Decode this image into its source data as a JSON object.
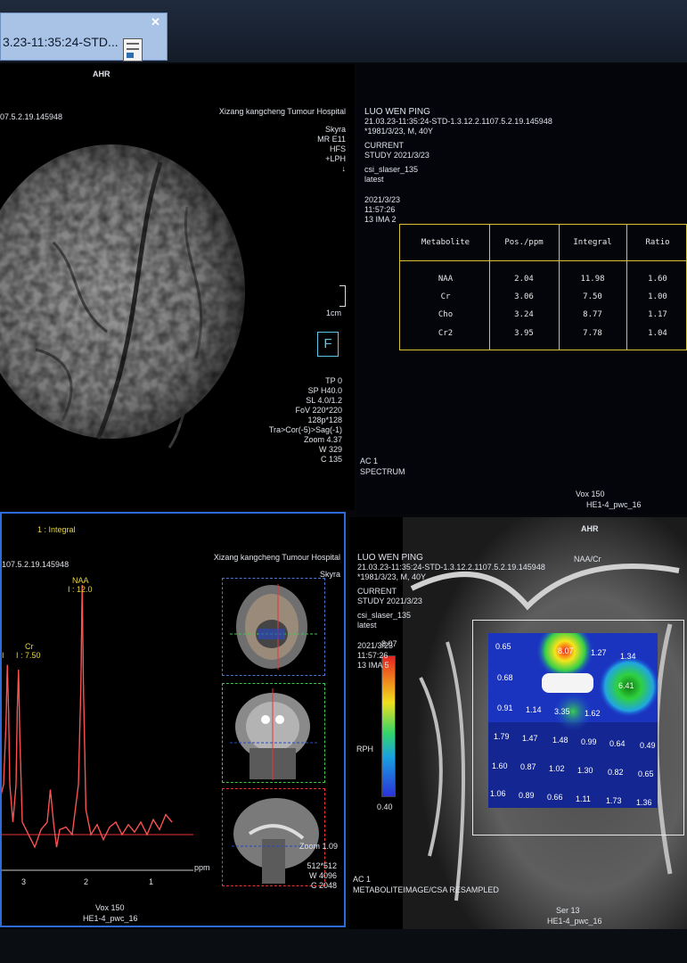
{
  "tab": {
    "title": "3.23-11:35:24-STD..."
  },
  "viewer1": {
    "orientation": "AHR",
    "id_partial": "07.5.2.19.145948",
    "hospital": "Xizang kangcheng Tumour Hospital",
    "scanner": [
      "Skyra",
      "MR E11",
      "HFS",
      "+LPH",
      "↓"
    ],
    "scale": "1cm",
    "params": [
      "TP 0",
      "SP H40.0",
      "SL 4.0/1.2",
      "FoV 220*220",
      "128p*128",
      "Tra>Cor(-5)>Sag(-1)",
      "Zoom 4.37",
      "W   329",
      "C   135"
    ]
  },
  "viewer2": {
    "patient": "LUO WEN PING",
    "study_id": "21.03.23-11:35:24-STD-1.3.12.2.1107.5.2.19.145948",
    "dob": "*1981/3/23, M, 40Y",
    "current": "CURRENT",
    "study": "STUDY 2021/3/23",
    "sequence": "csi_slaser_135",
    "latest": "latest",
    "date": "2021/3/23",
    "time": "11:57:26",
    "ima": "13 IMA 2",
    "ac": "AC 1",
    "mode": "SPECTRUM",
    "vox": "Vox 150",
    "coil": "HE1-4_pwc_16",
    "table": {
      "headers": [
        "Metabolite",
        "Pos./ppm",
        "Integral",
        "Ratio"
      ],
      "rows": [
        [
          "NAA",
          "2.04",
          "11.98",
          "1.60"
        ],
        [
          "Cr",
          "3.06",
          "7.50",
          "1.00"
        ],
        [
          "Cho",
          "3.24",
          "8.77",
          "1.17"
        ],
        [
          "Cr2",
          "3.95",
          "7.78",
          "1.04"
        ]
      ]
    }
  },
  "viewer3": {
    "mode": "1 : Integral",
    "id_partial": "107.5.2.19.145948",
    "hospital": "Xizang kangcheng Tumour Hospital",
    "scanner": "Skyra",
    "naa_label": "NAA",
    "naa_value": "I : 12.0",
    "cr_label": "Cr",
    "cr_value": "I : 7.50",
    "partial_label": "I",
    "axis_ticks": [
      "3",
      "2",
      "1"
    ],
    "axis_unit": "ppm",
    "zoom": "Zoom 1.09",
    "matrix": "512*512",
    "w": "W    4096",
    "c": "C    2048",
    "vox": "Vox 150",
    "coil": "HE1-4_pwc_16"
  },
  "viewer4": {
    "orientation": "AHR",
    "patient": "LUO WEN PING",
    "study_id": "21.03.23-11:35:24-STD-1.3.12.2.1107.5.2.19.145948",
    "dob": "*1981/3/23, M, 40Y",
    "current": "CURRENT",
    "study": "STUDY 2021/3/23",
    "sequence": "csi_slaser_135",
    "latest": "latest",
    "scale_max": "8.07",
    "date": "2021/3/23",
    "time": "11:57:26",
    "ima": "13 IMA 5",
    "rph": "RPH",
    "scale_min": "0.40",
    "naa_cr": "NAA/Cr",
    "ac": "AC 1",
    "mode": "METABOLITEIMAGE/CSA RESAMPLED",
    "ser": "Ser 13",
    "coil": "HE1-4_pwc_16",
    "grid_values": [
      "0.65",
      "8.07",
      "1.27",
      "1.34",
      "0.68",
      "6.41",
      "0.91",
      "1.14",
      "3.35",
      "1.62",
      "1.79",
      "1.47",
      "1.48",
      "0.99",
      "0.64",
      "0.49",
      "1.60",
      "0.87",
      "1.02",
      "1.30",
      "0.82",
      "0.65",
      "1.06",
      "0.89",
      "0.66",
      "1.11",
      "1.73",
      "1.36"
    ]
  },
  "spectrum": {
    "x_ppm": [
      4.2,
      4.1,
      4.0,
      3.98,
      3.95,
      3.92,
      3.9,
      3.8,
      3.4,
      3.3,
      3.26,
      3.24,
      3.22,
      3.2,
      3.15,
      3.1,
      3.08,
      3.06,
      3.04,
      3.0,
      2.9,
      2.8,
      2.7,
      2.6,
      2.55,
      2.5,
      2.45,
      2.4,
      2.3,
      2.2,
      2.1,
      2.06,
      2.04,
      2.02,
      1.98,
      1.9,
      1.8,
      1.7,
      1.6,
      1.5,
      1.4,
      1.3,
      1.2,
      1.1,
      1.0,
      0.9,
      0.8,
      0.7,
      0.6
    ],
    "y": [
      0.05,
      0.1,
      0.2,
      0.45,
      0.63,
      0.4,
      0.15,
      0.05,
      0.1,
      0.2,
      0.45,
      0.68,
      0.5,
      0.2,
      0.05,
      0.2,
      0.5,
      0.66,
      0.4,
      0.05,
      0.0,
      -0.05,
      0.02,
      0.05,
      0.18,
      0.05,
      -0.05,
      0.02,
      0.03,
      0.0,
      0.2,
      0.6,
      1.0,
      0.6,
      0.1,
      0.0,
      0.04,
      -0.02,
      0.03,
      0.05,
      0.0,
      0.04,
      0.01,
      0.05,
      0.0,
      0.06,
      0.02,
      0.08,
      0.05
    ]
  }
}
